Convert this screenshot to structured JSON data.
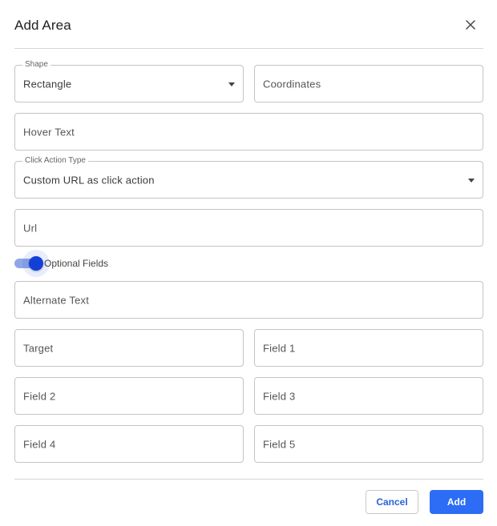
{
  "dialog": {
    "title": "Add Area",
    "close_icon": "close-icon"
  },
  "shape": {
    "label": "Shape",
    "value": "Rectangle"
  },
  "coordinates": {
    "placeholder": "Coordinates"
  },
  "hover_text": {
    "placeholder": "Hover Text"
  },
  "click_action_type": {
    "label": "Click Action Type",
    "value": "Custom URL as click action"
  },
  "url": {
    "placeholder": "Url"
  },
  "optional_fields": {
    "label": "Optional Fields",
    "enabled": true
  },
  "alternate_text": {
    "placeholder": "Alternate Text"
  },
  "target": {
    "placeholder": "Target"
  },
  "field1": {
    "placeholder": "Field 1"
  },
  "field2": {
    "placeholder": "Field 2"
  },
  "field3": {
    "placeholder": "Field 3"
  },
  "field4": {
    "placeholder": "Field 4"
  },
  "field5": {
    "placeholder": "Field 5"
  },
  "actions": {
    "cancel_label": "Cancel",
    "add_label": "Add"
  },
  "colors": {
    "primary": "#2d6cf5",
    "toggle_knob": "#1240d6",
    "toggle_track": "#8fa6e6",
    "border": "#c4c4c4"
  }
}
